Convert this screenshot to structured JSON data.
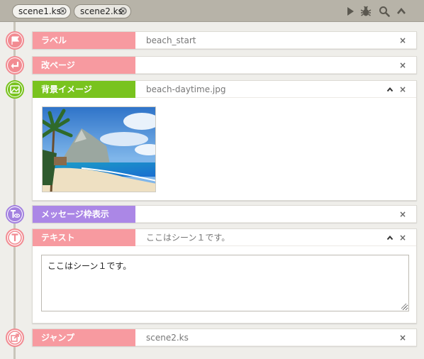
{
  "tabs": [
    {
      "label": "scene1.ks",
      "active": false
    },
    {
      "label": "scene2.ks",
      "active": true
    }
  ],
  "toolbar": {
    "icons": [
      "play-icon",
      "bug-icon",
      "search-icon",
      "chevron-up-icon"
    ]
  },
  "colors": {
    "label_pink": "#f79aa0",
    "label_green": "#79c31e",
    "label_purple": "#ab87e6",
    "topbar": "#b7b3a8"
  },
  "cards": [
    {
      "label": "ラベル",
      "value": "beach_start",
      "icon": "flag-icon",
      "close": "×"
    },
    {
      "label": "改ページ",
      "value": "",
      "icon": "return-icon",
      "close": "×"
    },
    {
      "label": "背景イメージ",
      "value": "beach-daytime.jpg",
      "icon": "background-image-icon",
      "close": "×",
      "collapse": "^"
    },
    {
      "label": "メッセージ枠表示",
      "value": "",
      "icon": "message-window-icon",
      "close": "×"
    },
    {
      "label": "テキスト",
      "value": "ここはシーン１です。",
      "icon": "text-icon",
      "close": "×",
      "collapse": "^",
      "text_content": "ここはシーン１です。"
    },
    {
      "label": "ジャンプ",
      "value": "scene2.ks",
      "icon": "jump-icon",
      "close": "×"
    }
  ]
}
